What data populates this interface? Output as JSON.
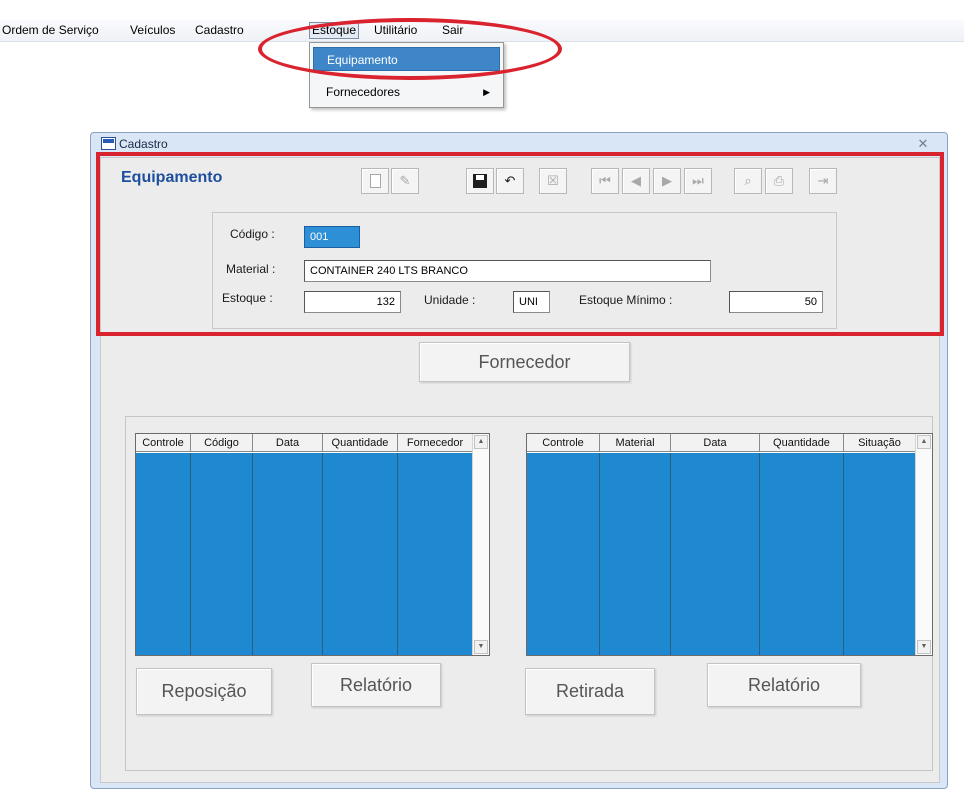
{
  "menubar": {
    "items": [
      "Ordem de Serviço",
      "Veículos",
      "Cadastro",
      "Estoque",
      "Utilitário",
      "Sair"
    ]
  },
  "dropdown": {
    "items": [
      "Equipamento",
      "Fornecedores"
    ]
  },
  "window": {
    "title": "Cadastro",
    "close_glyph": "✕"
  },
  "form": {
    "heading": "Equipamento",
    "codigo_label": "Código :",
    "codigo_value": "001",
    "material_label": "Material :",
    "material_value": "CONTAINER 240 LTS BRANCO",
    "estoque_label": "Estoque :",
    "estoque_value": "132",
    "unidade_label": "Unidade :",
    "unidade_value": "UNI",
    "estoque_minimo_label": "Estoque Mínimo :",
    "estoque_minimo_value": "50"
  },
  "toolbar": {
    "icons": [
      "new-doc-icon",
      "edit-icon",
      "save-icon",
      "undo-icon",
      "delete-icon",
      "first-record-icon",
      "prev-record-icon",
      "next-record-icon",
      "last-record-icon",
      "search-icon",
      "print-icon",
      "exit-icon"
    ]
  },
  "buttons": {
    "fornecedor": "Fornecedor",
    "reposicao": "Reposição",
    "relatorio_left": "Relatório",
    "retirada": "Retirada",
    "relatorio_right": "Relatório"
  },
  "grid_left": {
    "columns": [
      "Controle",
      "Código",
      "Data",
      "Quantidade",
      "Fornecedor"
    ]
  },
  "grid_right": {
    "columns": [
      "Controle",
      "Material",
      "Data",
      "Quantidade",
      "Situação"
    ]
  },
  "colors": {
    "highlight_red": "#d9232e",
    "grid_blue": "#1e88d0",
    "heading_blue": "#1e4f9e",
    "menu_selection": "#3f86c8"
  }
}
